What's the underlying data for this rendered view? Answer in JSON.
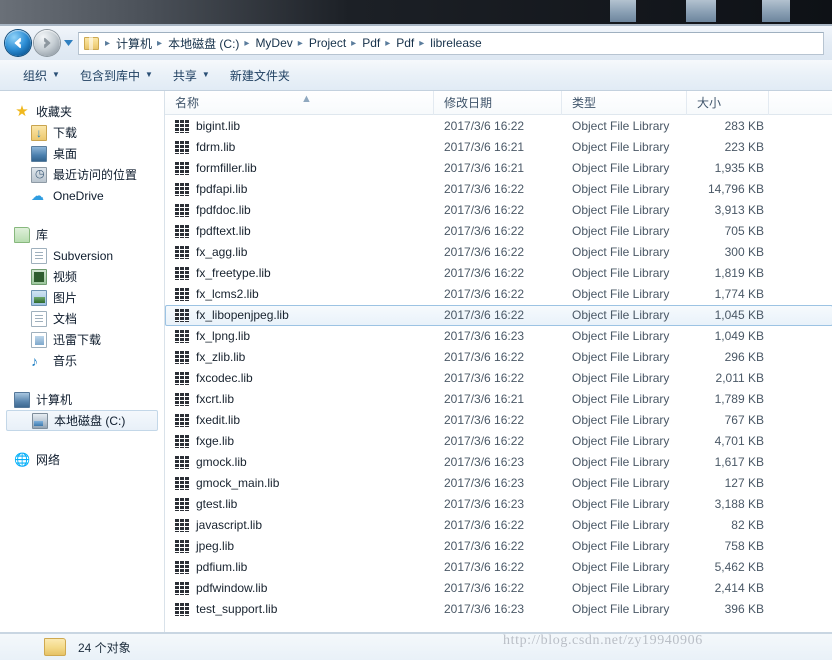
{
  "window": {
    "title_strip": "cropped-title-bar"
  },
  "address_bar": {
    "back_tooltip": "后退",
    "forward_tooltip": "前进",
    "history_tooltip": "最近浏览的位置",
    "breadcrumbs": [
      "计算机",
      "本地磁盘 (C:)",
      "MyDev",
      "Project",
      "Pdf",
      "Pdf",
      "librelease"
    ],
    "separator": "▸"
  },
  "command_bar": {
    "items": [
      {
        "label": "组织",
        "has_caret": true
      },
      {
        "label": "包含到库中",
        "has_caret": true
      },
      {
        "label": "共享",
        "has_caret": true
      },
      {
        "label": "新建文件夹",
        "has_caret": false
      }
    ],
    "caret": "▼"
  },
  "nav_pane": {
    "groups": [
      {
        "header": {
          "label": "收藏夹",
          "icon": "star-icon"
        },
        "items": [
          {
            "label": "下载",
            "icon": "downloads-icon"
          },
          {
            "label": "桌面",
            "icon": "desktop-icon"
          },
          {
            "label": "最近访问的位置",
            "icon": "recent-places-icon"
          },
          {
            "label": "OneDrive",
            "icon": "onedrive-cloud-icon"
          }
        ]
      },
      {
        "header": {
          "label": "库",
          "icon": "library-icon"
        },
        "items": [
          {
            "label": "Subversion",
            "icon": "document-icon"
          },
          {
            "label": "视频",
            "icon": "video-icon"
          },
          {
            "label": "图片",
            "icon": "pictures-icon"
          },
          {
            "label": "文档",
            "icon": "document-icon"
          },
          {
            "label": "迅雷下载",
            "icon": "thunder-download-icon"
          },
          {
            "label": "音乐",
            "icon": "music-note-icon"
          }
        ]
      },
      {
        "header": {
          "label": "计算机",
          "icon": "computer-icon"
        },
        "items": [
          {
            "label": "本地磁盘 (C:)",
            "icon": "hard-drive-icon",
            "selected": true
          }
        ]
      },
      {
        "header": {
          "label": "网络",
          "icon": "network-icon"
        },
        "items": []
      }
    ]
  },
  "file_list": {
    "columns": [
      {
        "key": "name",
        "label": "名称",
        "sorted": "asc"
      },
      {
        "key": "date",
        "label": "修改日期"
      },
      {
        "key": "type",
        "label": "类型"
      },
      {
        "key": "size",
        "label": "大小"
      }
    ],
    "sort_indicator": "▲",
    "rows": [
      {
        "name": "bigint.lib",
        "date": "2017/3/6 16:22",
        "type": "Object File Library",
        "size": "283 KB",
        "selected": false
      },
      {
        "name": "fdrm.lib",
        "date": "2017/3/6 16:21",
        "type": "Object File Library",
        "size": "223 KB",
        "selected": false
      },
      {
        "name": "formfiller.lib",
        "date": "2017/3/6 16:21",
        "type": "Object File Library",
        "size": "1,935 KB",
        "selected": false
      },
      {
        "name": "fpdfapi.lib",
        "date": "2017/3/6 16:22",
        "type": "Object File Library",
        "size": "14,796 KB",
        "selected": false
      },
      {
        "name": "fpdfdoc.lib",
        "date": "2017/3/6 16:22",
        "type": "Object File Library",
        "size": "3,913 KB",
        "selected": false
      },
      {
        "name": "fpdftext.lib",
        "date": "2017/3/6 16:22",
        "type": "Object File Library",
        "size": "705 KB",
        "selected": false
      },
      {
        "name": "fx_agg.lib",
        "date": "2017/3/6 16:22",
        "type": "Object File Library",
        "size": "300 KB",
        "selected": false
      },
      {
        "name": "fx_freetype.lib",
        "date": "2017/3/6 16:22",
        "type": "Object File Library",
        "size": "1,819 KB",
        "selected": false
      },
      {
        "name": "fx_lcms2.lib",
        "date": "2017/3/6 16:22",
        "type": "Object File Library",
        "size": "1,774 KB",
        "selected": false
      },
      {
        "name": "fx_libopenjpeg.lib",
        "date": "2017/3/6 16:22",
        "type": "Object File Library",
        "size": "1,045 KB",
        "selected": true
      },
      {
        "name": "fx_lpng.lib",
        "date": "2017/3/6 16:23",
        "type": "Object File Library",
        "size": "1,049 KB",
        "selected": false
      },
      {
        "name": "fx_zlib.lib",
        "date": "2017/3/6 16:22",
        "type": "Object File Library",
        "size": "296 KB",
        "selected": false
      },
      {
        "name": "fxcodec.lib",
        "date": "2017/3/6 16:22",
        "type": "Object File Library",
        "size": "2,011 KB",
        "selected": false
      },
      {
        "name": "fxcrt.lib",
        "date": "2017/3/6 16:21",
        "type": "Object File Library",
        "size": "1,789 KB",
        "selected": false
      },
      {
        "name": "fxedit.lib",
        "date": "2017/3/6 16:22",
        "type": "Object File Library",
        "size": "767 KB",
        "selected": false
      },
      {
        "name": "fxge.lib",
        "date": "2017/3/6 16:22",
        "type": "Object File Library",
        "size": "4,701 KB",
        "selected": false
      },
      {
        "name": "gmock.lib",
        "date": "2017/3/6 16:23",
        "type": "Object File Library",
        "size": "1,617 KB",
        "selected": false
      },
      {
        "name": "gmock_main.lib",
        "date": "2017/3/6 16:23",
        "type": "Object File Library",
        "size": "127 KB",
        "selected": false
      },
      {
        "name": "gtest.lib",
        "date": "2017/3/6 16:23",
        "type": "Object File Library",
        "size": "3,188 KB",
        "selected": false
      },
      {
        "name": "javascript.lib",
        "date": "2017/3/6 16:22",
        "type": "Object File Library",
        "size": "82 KB",
        "selected": false
      },
      {
        "name": "jpeg.lib",
        "date": "2017/3/6 16:22",
        "type": "Object File Library",
        "size": "758 KB",
        "selected": false
      },
      {
        "name": "pdfium.lib",
        "date": "2017/3/6 16:22",
        "type": "Object File Library",
        "size": "5,462 KB",
        "selected": false
      },
      {
        "name": "pdfwindow.lib",
        "date": "2017/3/6 16:22",
        "type": "Object File Library",
        "size": "2,414 KB",
        "selected": false
      },
      {
        "name": "test_support.lib",
        "date": "2017/3/6 16:23",
        "type": "Object File Library",
        "size": "396 KB",
        "selected": false
      }
    ]
  },
  "status_bar": {
    "item_count_text": "24 个对象",
    "folder_icon": "folder-icon"
  },
  "watermark": {
    "text": "http://blog.csdn.net/zy19940906"
  },
  "colors": {
    "accent_blue": "#2e8fd6",
    "selection_border": "#9cc3e3",
    "selection_fill": "#e9f2fa",
    "chrome_blue": "#e4ecf5",
    "folder_yellow": "#f3d988"
  }
}
